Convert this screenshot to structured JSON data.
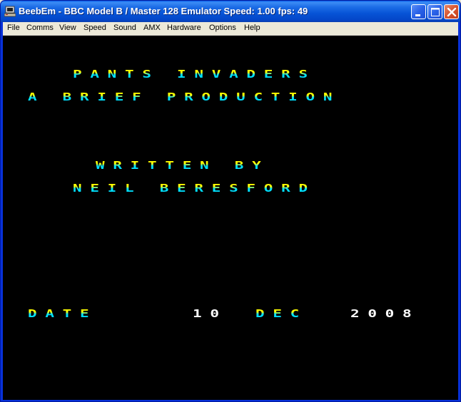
{
  "window": {
    "title": "BeebEm - BBC Model B / Master 128 Emulator  Speed: 1.00  fps: 49",
    "buttons": [
      "minimize",
      "maximize",
      "close"
    ]
  },
  "menu": {
    "items": [
      "File",
      "Comms",
      "View",
      "Speed",
      "Sound",
      "AMX",
      "Hardware",
      "Options",
      "Help"
    ]
  },
  "screen": {
    "line1": "PANTS INVADERS",
    "line2": "A BRIEF PRODUCTION",
    "line3": "WRITTEN BY",
    "line4": "NEIL BERESFORD",
    "date_label": "DATE",
    "date_day": "10",
    "date_month": "DEC",
    "date_year": "2008"
  },
  "colors": {
    "title_gradient_top": "#ffff00",
    "title_gradient_bottom": "#00e0ff",
    "screen_background": "#000000",
    "plain_text": "#ffffff"
  },
  "icons": {
    "app": "beebem-computer-icon",
    "minimize": "minimize-icon",
    "maximize": "maximize-icon",
    "close": "close-icon"
  }
}
